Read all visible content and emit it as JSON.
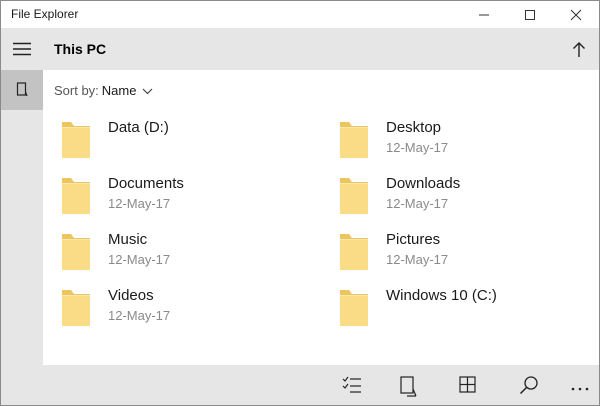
{
  "window": {
    "title": "File Explorer"
  },
  "header": {
    "title": "This PC"
  },
  "sort": {
    "label": "Sort by:",
    "value": "Name"
  },
  "items": [
    {
      "name": "Data (D:)",
      "date": ""
    },
    {
      "name": "Desktop",
      "date": "12-May-17"
    },
    {
      "name": "Documents",
      "date": "12-May-17"
    },
    {
      "name": "Downloads",
      "date": "12-May-17"
    },
    {
      "name": "Music",
      "date": "12-May-17"
    },
    {
      "name": "Pictures",
      "date": "12-May-17"
    },
    {
      "name": "Videos",
      "date": "12-May-17"
    },
    {
      "name": "Windows 10 (C:)",
      "date": ""
    }
  ],
  "colors": {
    "folder": "#fbdc86",
    "folder_dark": "#eec45d",
    "bars": "#e6e6e6",
    "selected": "#c3c3c3"
  },
  "icons": {
    "titlebar": [
      "minimize-icon",
      "maximize-icon",
      "close-icon"
    ],
    "sidebar": [
      "hamburger-menu-icon",
      "device-icon"
    ],
    "header": [
      "arrow-up-icon"
    ],
    "bottombar": [
      "select-list-icon",
      "new-window-icon",
      "grid-view-icon",
      "search-icon",
      "more-icon"
    ]
  }
}
